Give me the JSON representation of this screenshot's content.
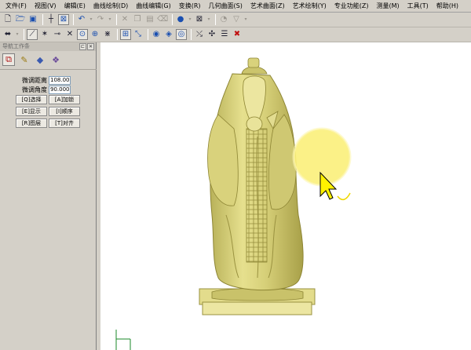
{
  "menubar": {
    "items": [
      "文件(F)",
      "视图(V)",
      "编辑(E)",
      "曲线绘制(D)",
      "曲线编辑(G)",
      "变换(R)",
      "几何曲面(S)",
      "艺术曲面(Z)",
      "艺术绘制(Y)",
      "专业功能(Z)",
      "测量(M)",
      "工具(T)",
      "帮助(H)"
    ]
  },
  "panel": {
    "title": "导航工作条",
    "distance_label": "微调距离",
    "distance_value": "108.00",
    "angle_label": "微调角度",
    "angle_value": "90.000",
    "buttons": [
      "[Q]选择",
      "[A]加锁",
      "[E]显示",
      "[I]顺序",
      "[R]图层",
      "[T]对齐"
    ]
  },
  "colors": {
    "accent_highlight": "#fbf07a",
    "statue": "#d8d27a",
    "toolbar_bg": "#d4d0c8"
  },
  "icons": {
    "toolbar1": [
      "new-file-icon",
      "open-file-icon",
      "save-icon",
      "cross-cursor-icon",
      "select-box-icon",
      "undo-icon",
      "redo-icon",
      "cut-icon",
      "copy-icon",
      "paste-icon",
      "delete-icon",
      "sphere-render-icon",
      "wireframe-icon",
      "render-mode-icon",
      "color-icon"
    ],
    "toolbar2": [
      "node-tool-icon",
      "snap-icon",
      "line-tool-icon",
      "cross-icon",
      "circle-snap-icon",
      "target-snap-icon",
      "intersect-icon",
      "grid-icon",
      "resize-icon",
      "eye-icon",
      "view-icon",
      "view-mode-icon",
      "pick-icon",
      "transform-icon",
      "list-icon",
      "close-red-icon"
    ]
  }
}
